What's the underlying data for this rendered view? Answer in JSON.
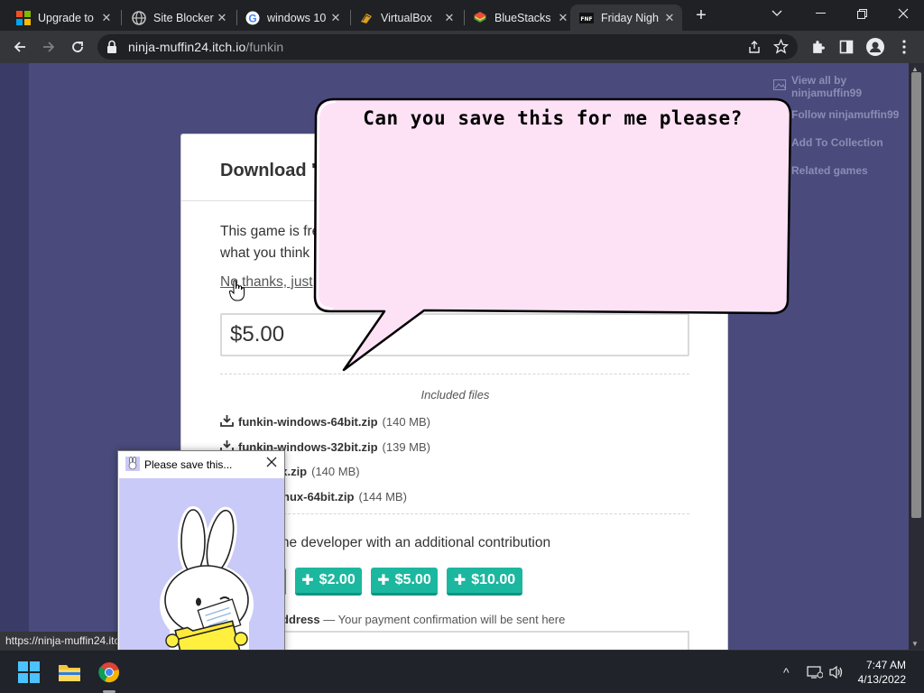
{
  "browser": {
    "tabs": [
      {
        "title": "Upgrade to",
        "icon": "windows-logo-icon",
        "active": false
      },
      {
        "title": "Site Blocker",
        "icon": "globe-icon",
        "active": false
      },
      {
        "title": "windows 10",
        "icon": "google-icon",
        "active": false
      },
      {
        "title": "VirtualBox",
        "icon": "virtualbox-icon",
        "active": false
      },
      {
        "title": "BlueStacks",
        "icon": "bluestacks-icon",
        "active": false
      },
      {
        "title": "Friday Nigh",
        "icon": "fnf-icon",
        "active": true
      }
    ],
    "new_tab": "+",
    "url_host": "ninja-muffin24.itch.io",
    "url_path": "/funkin"
  },
  "sidebar": {
    "items": [
      {
        "label": "View all by ninjamuffin99",
        "icon": "image-icon"
      },
      {
        "label": "Follow ninjamuffin99",
        "icon": "follow-icon"
      },
      {
        "label": "Add To Collection",
        "icon": "add-list-icon"
      },
      {
        "label": "Related games",
        "icon": "map-icon"
      }
    ]
  },
  "download": {
    "title": "Download 'l",
    "intro_line1": "This game is fre",
    "intro_line2": "what you think",
    "no_thanks": "No thanks, just",
    "price": "$5.00",
    "included_files": "Included files",
    "files": [
      {
        "name": "funkin-windows-64bit.zip",
        "size": "(140 MB)"
      },
      {
        "name": "funkin-windows-32bit.zip",
        "size": "(139 MB)"
      },
      {
        "name": "sx.zip",
        "size": "(140 MB)"
      },
      {
        "name": "nux-64bit.zip",
        "size": "(144 MB)"
      }
    ],
    "support_text": "t the developer with an additional contribution",
    "tips": [
      "$2.00",
      "$5.00",
      "$10.00"
    ],
    "email_label": "ddress",
    "email_hint": " — Your payment confirmation will be sent here"
  },
  "bubble": {
    "text": "Can you save this for me please?"
  },
  "status_url": "https://ninja-muffin24.itch.io",
  "popup": {
    "title": "Please save this..."
  },
  "taskbar": {
    "time": "7:47 AM",
    "date": "4/13/2022",
    "up_arrow": "^"
  },
  "colors": {
    "accent": "#1cb79f",
    "page_bg": "#4a4b7c",
    "bubble_fill": "#fde2f6"
  }
}
